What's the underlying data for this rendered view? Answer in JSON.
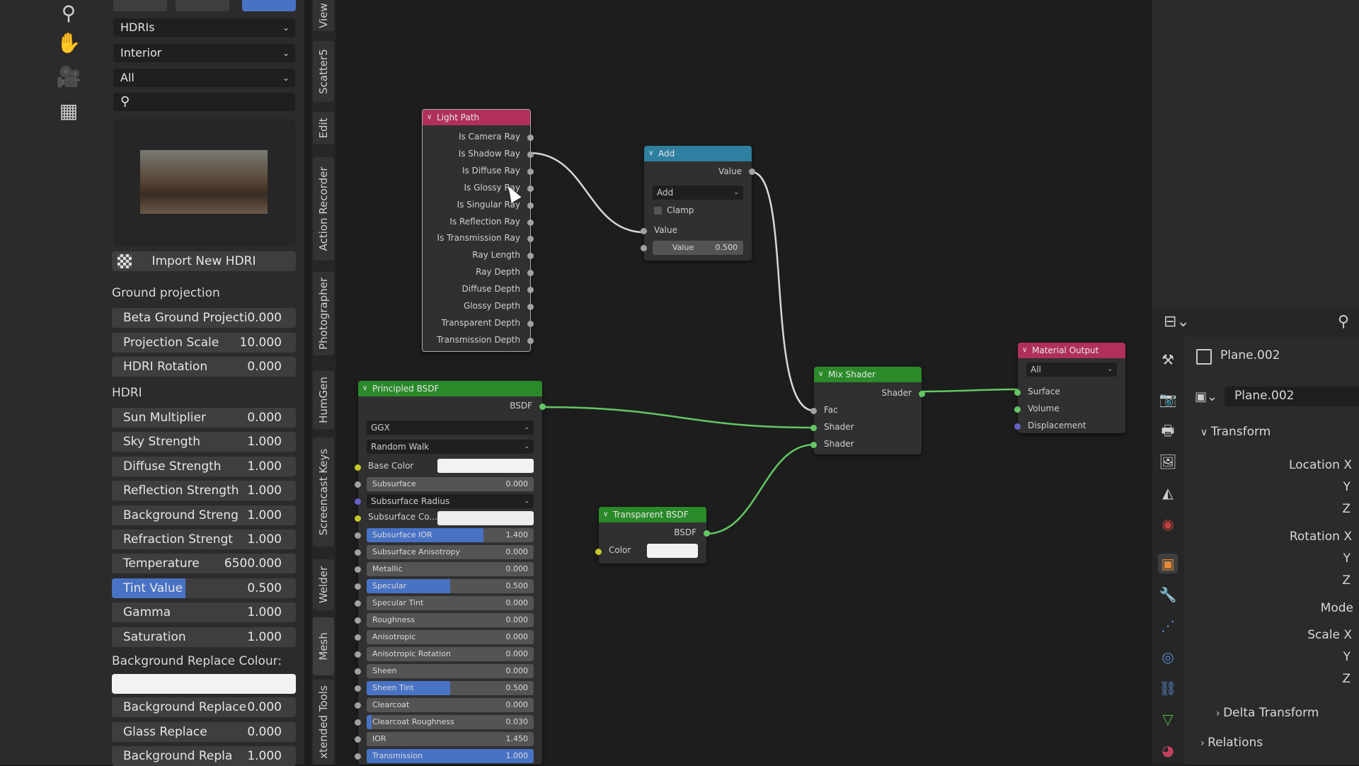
{
  "hdri_panel": {
    "category": "HDRIs",
    "subcategory": "Interior",
    "filter": "All",
    "search_placeholder": "",
    "import_button": "Import New HDRI",
    "ground_section": "Ground projection",
    "ground_fields": [
      {
        "label": "Beta Ground Projecti",
        "value": "0.000"
      },
      {
        "label": "Projection Scale",
        "value": "10.000"
      },
      {
        "label": "HDRI Rotation",
        "value": "0.000"
      }
    ],
    "hdri_section": "HDRI",
    "hdri_fields": [
      {
        "label": "Sun Multiplier",
        "value": "0.000"
      },
      {
        "label": "Sky Strength",
        "value": "1.000"
      },
      {
        "label": "Diffuse Strength",
        "value": "1.000"
      },
      {
        "label": "Reflection Strength",
        "value": "1.000"
      },
      {
        "label": "Background Streng",
        "value": "1.000"
      },
      {
        "label": "Refraction Strengt",
        "value": "1.000"
      },
      {
        "label": "Temperature",
        "value": "6500.000"
      },
      {
        "label": "Tint Value",
        "value": "0.500",
        "fill": 0.4
      },
      {
        "label": "Gamma",
        "value": "1.000"
      },
      {
        "label": "Saturation",
        "value": "1.000"
      }
    ],
    "bg_colour_label": "Background Replace Colour:",
    "bottom_fields": [
      {
        "label": "Background Replace",
        "value": "0.000"
      },
      {
        "label": "Glass Replace",
        "value": "0.000"
      },
      {
        "label": "Background Repla",
        "value": "1.000"
      }
    ]
  },
  "vertical_tabs": [
    "View",
    "Scatter5",
    "Edit",
    "Action Recorder",
    "Photographer",
    "HumGen",
    "Screencast Keys",
    "Welder",
    "Mesh",
    "xtended Tools"
  ],
  "nodes": {
    "light_path": {
      "title": "Light Path",
      "outputs": [
        "Is Camera Ray",
        "Is Shadow Ray",
        "Is Diffuse Ray",
        "Is Glossy Ray",
        "Is Singular Ray",
        "Is Reflection Ray",
        "Is Transmission Ray",
        "Ray Length",
        "Ray Depth",
        "Diffuse Depth",
        "Glossy Depth",
        "Transparent Depth",
        "Transmission Depth"
      ]
    },
    "add": {
      "title": "Add",
      "output": "Value",
      "operation": "Add",
      "clamp": "Clamp",
      "input_label": "Value",
      "value_label": "Value",
      "value": "0.500"
    },
    "principled": {
      "title": "Principled BSDF",
      "output": "BSDF",
      "distribution": "GGX",
      "subsurface_method": "Random Walk",
      "base_color": "Base Color",
      "subsurface": {
        "label": "Subsurface",
        "value": "0.000"
      },
      "subsurface_radius": "Subsurface Radius",
      "subsurface_color": "Subsurface Co...",
      "rows": [
        {
          "label": "Subsurface IOR",
          "value": "1.400",
          "fill": 0.7
        },
        {
          "label": "Subsurface Anisotropy",
          "value": "0.000"
        },
        {
          "label": "Metallic",
          "value": "0.000"
        },
        {
          "label": "Specular",
          "value": "0.500",
          "fill": 0.5
        },
        {
          "label": "Specular Tint",
          "value": "0.000"
        },
        {
          "label": "Roughness",
          "value": "0.000"
        },
        {
          "label": "Anisotropic",
          "value": "0.000"
        },
        {
          "label": "Anisotropic Rotation",
          "value": "0.000"
        },
        {
          "label": "Sheen",
          "value": "0.000"
        },
        {
          "label": "Sheen Tint",
          "value": "0.500",
          "fill": 0.5
        },
        {
          "label": "Clearcoat",
          "value": "0.000"
        },
        {
          "label": "Clearcoat Roughness",
          "value": "0.030",
          "fill": 0.03
        },
        {
          "label": "IOR",
          "value": "1.450"
        },
        {
          "label": "Transmission",
          "value": "1.000",
          "fill": 1.0
        }
      ]
    },
    "transparent": {
      "title": "Transparent BSDF",
      "output": "BSDF",
      "color": "Color"
    },
    "mix": {
      "title": "Mix Shader",
      "output": "Shader",
      "inputs": [
        "Fac",
        "Shader",
        "Shader"
      ]
    },
    "output": {
      "title": "Material Output",
      "target": "All",
      "inputs": [
        "Surface",
        "Volume",
        "Displacement"
      ]
    }
  },
  "properties": {
    "object_name": "Plane.002",
    "data_name": "Plane.002",
    "transform": "Transform",
    "location": "Location X",
    "loc_y": "Y",
    "loc_z": "Z",
    "rotation": "Rotation X",
    "rot_y": "Y",
    "rot_z": "Z",
    "mode": "Mode",
    "scale": "Scale X",
    "scale_y": "Y",
    "scale_z": "Z",
    "delta": "Delta Transform",
    "relations": "Relations"
  },
  "colors": {
    "light_path_header": "#b0305a",
    "add_header": "#2f7fa0",
    "shader_header": "#2a8a2a",
    "output_header": "#b0305a",
    "accent": "#4872c4"
  }
}
